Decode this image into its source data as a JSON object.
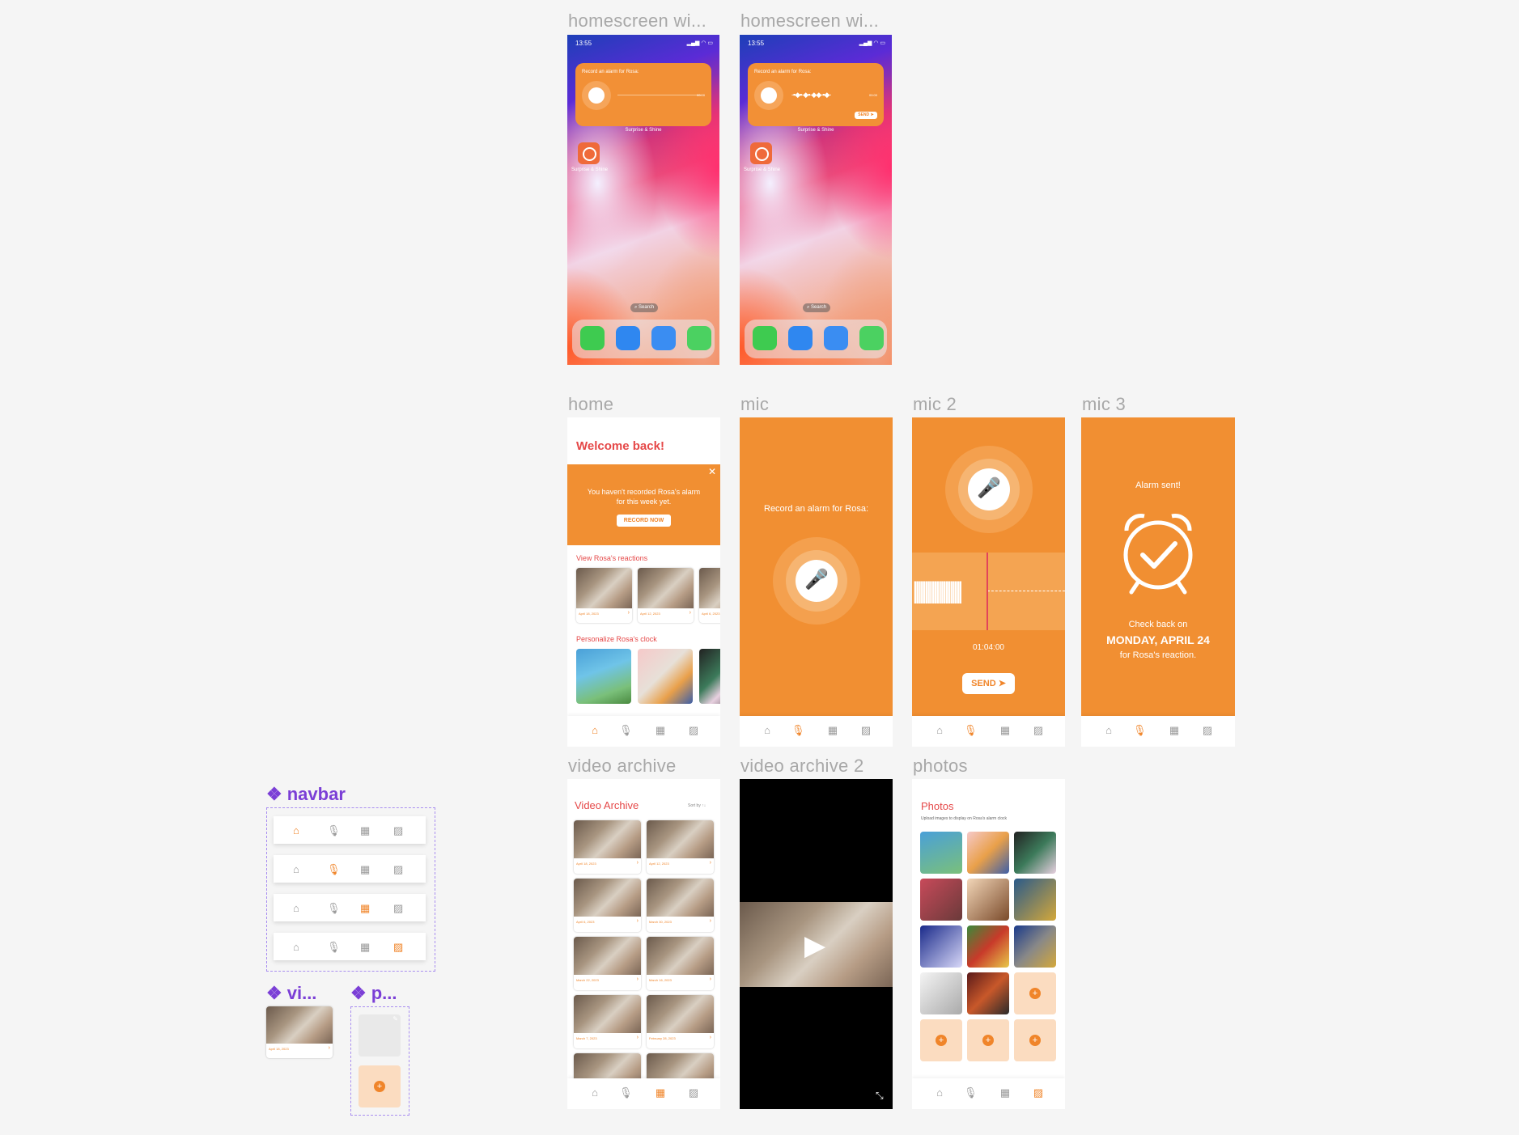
{
  "frames": {
    "hs1": {
      "label": "homescreen wi..."
    },
    "hs2": {
      "label": "homescreen wi..."
    },
    "home": {
      "label": "home"
    },
    "mic": {
      "label": "mic"
    },
    "mic2": {
      "label": "mic 2"
    },
    "mic3": {
      "label": "mic 3"
    },
    "va": {
      "label": "video archive"
    },
    "va2": {
      "label": "video archive 2"
    },
    "photos": {
      "label": "photos"
    }
  },
  "homescreen": {
    "time": "13:55",
    "widget_text": "Record an alarm for Rosa:",
    "widget_time": "00:00",
    "send": "SEND",
    "app_name": "Surprise & Shine",
    "search": "Search"
  },
  "home": {
    "welcome": "Welcome back!",
    "banner_text": "You haven't recorded Rosa's alarm for this week yet.",
    "record_now": "RECORD NOW",
    "reactions_title": "View Rosa's reactions",
    "reaction_dates": [
      "April 18, 2023",
      "April 12, 2023",
      "April 6, 2023"
    ],
    "personalize_title": "Personalize Rosa's clock"
  },
  "mic": {
    "prompt": "Record an alarm for Rosa:"
  },
  "mic2": {
    "time": "01:04:00",
    "send": "SEND"
  },
  "mic3": {
    "sent": "Alarm sent!",
    "check": "Check back on",
    "date": "MONDAY, APRIL 24",
    "for": "for Rosa's reaction."
  },
  "video_archive": {
    "title": "Video Archive",
    "sort": "Sort by",
    "dates": [
      "April 18, 2023",
      "April 12, 2023",
      "April 6, 2023",
      "March 30, 2023",
      "March 22, 2023",
      "March 16, 2023",
      "March 7, 2023",
      "February 28, 2023"
    ]
  },
  "photos": {
    "title": "Photos",
    "subtitle": "Upload images to display on Rosa's alarm clock"
  },
  "components": {
    "navbar": "navbar",
    "video": "vi...",
    "photo": "p...",
    "component_date": "April 18, 2023"
  },
  "nav_icons": [
    "home-icon",
    "mic-icon",
    "film-icon",
    "image-icon"
  ],
  "colors": {
    "accent": "#f18f32",
    "title_red": "#e54848",
    "component_purple": "#7b3fd6"
  }
}
